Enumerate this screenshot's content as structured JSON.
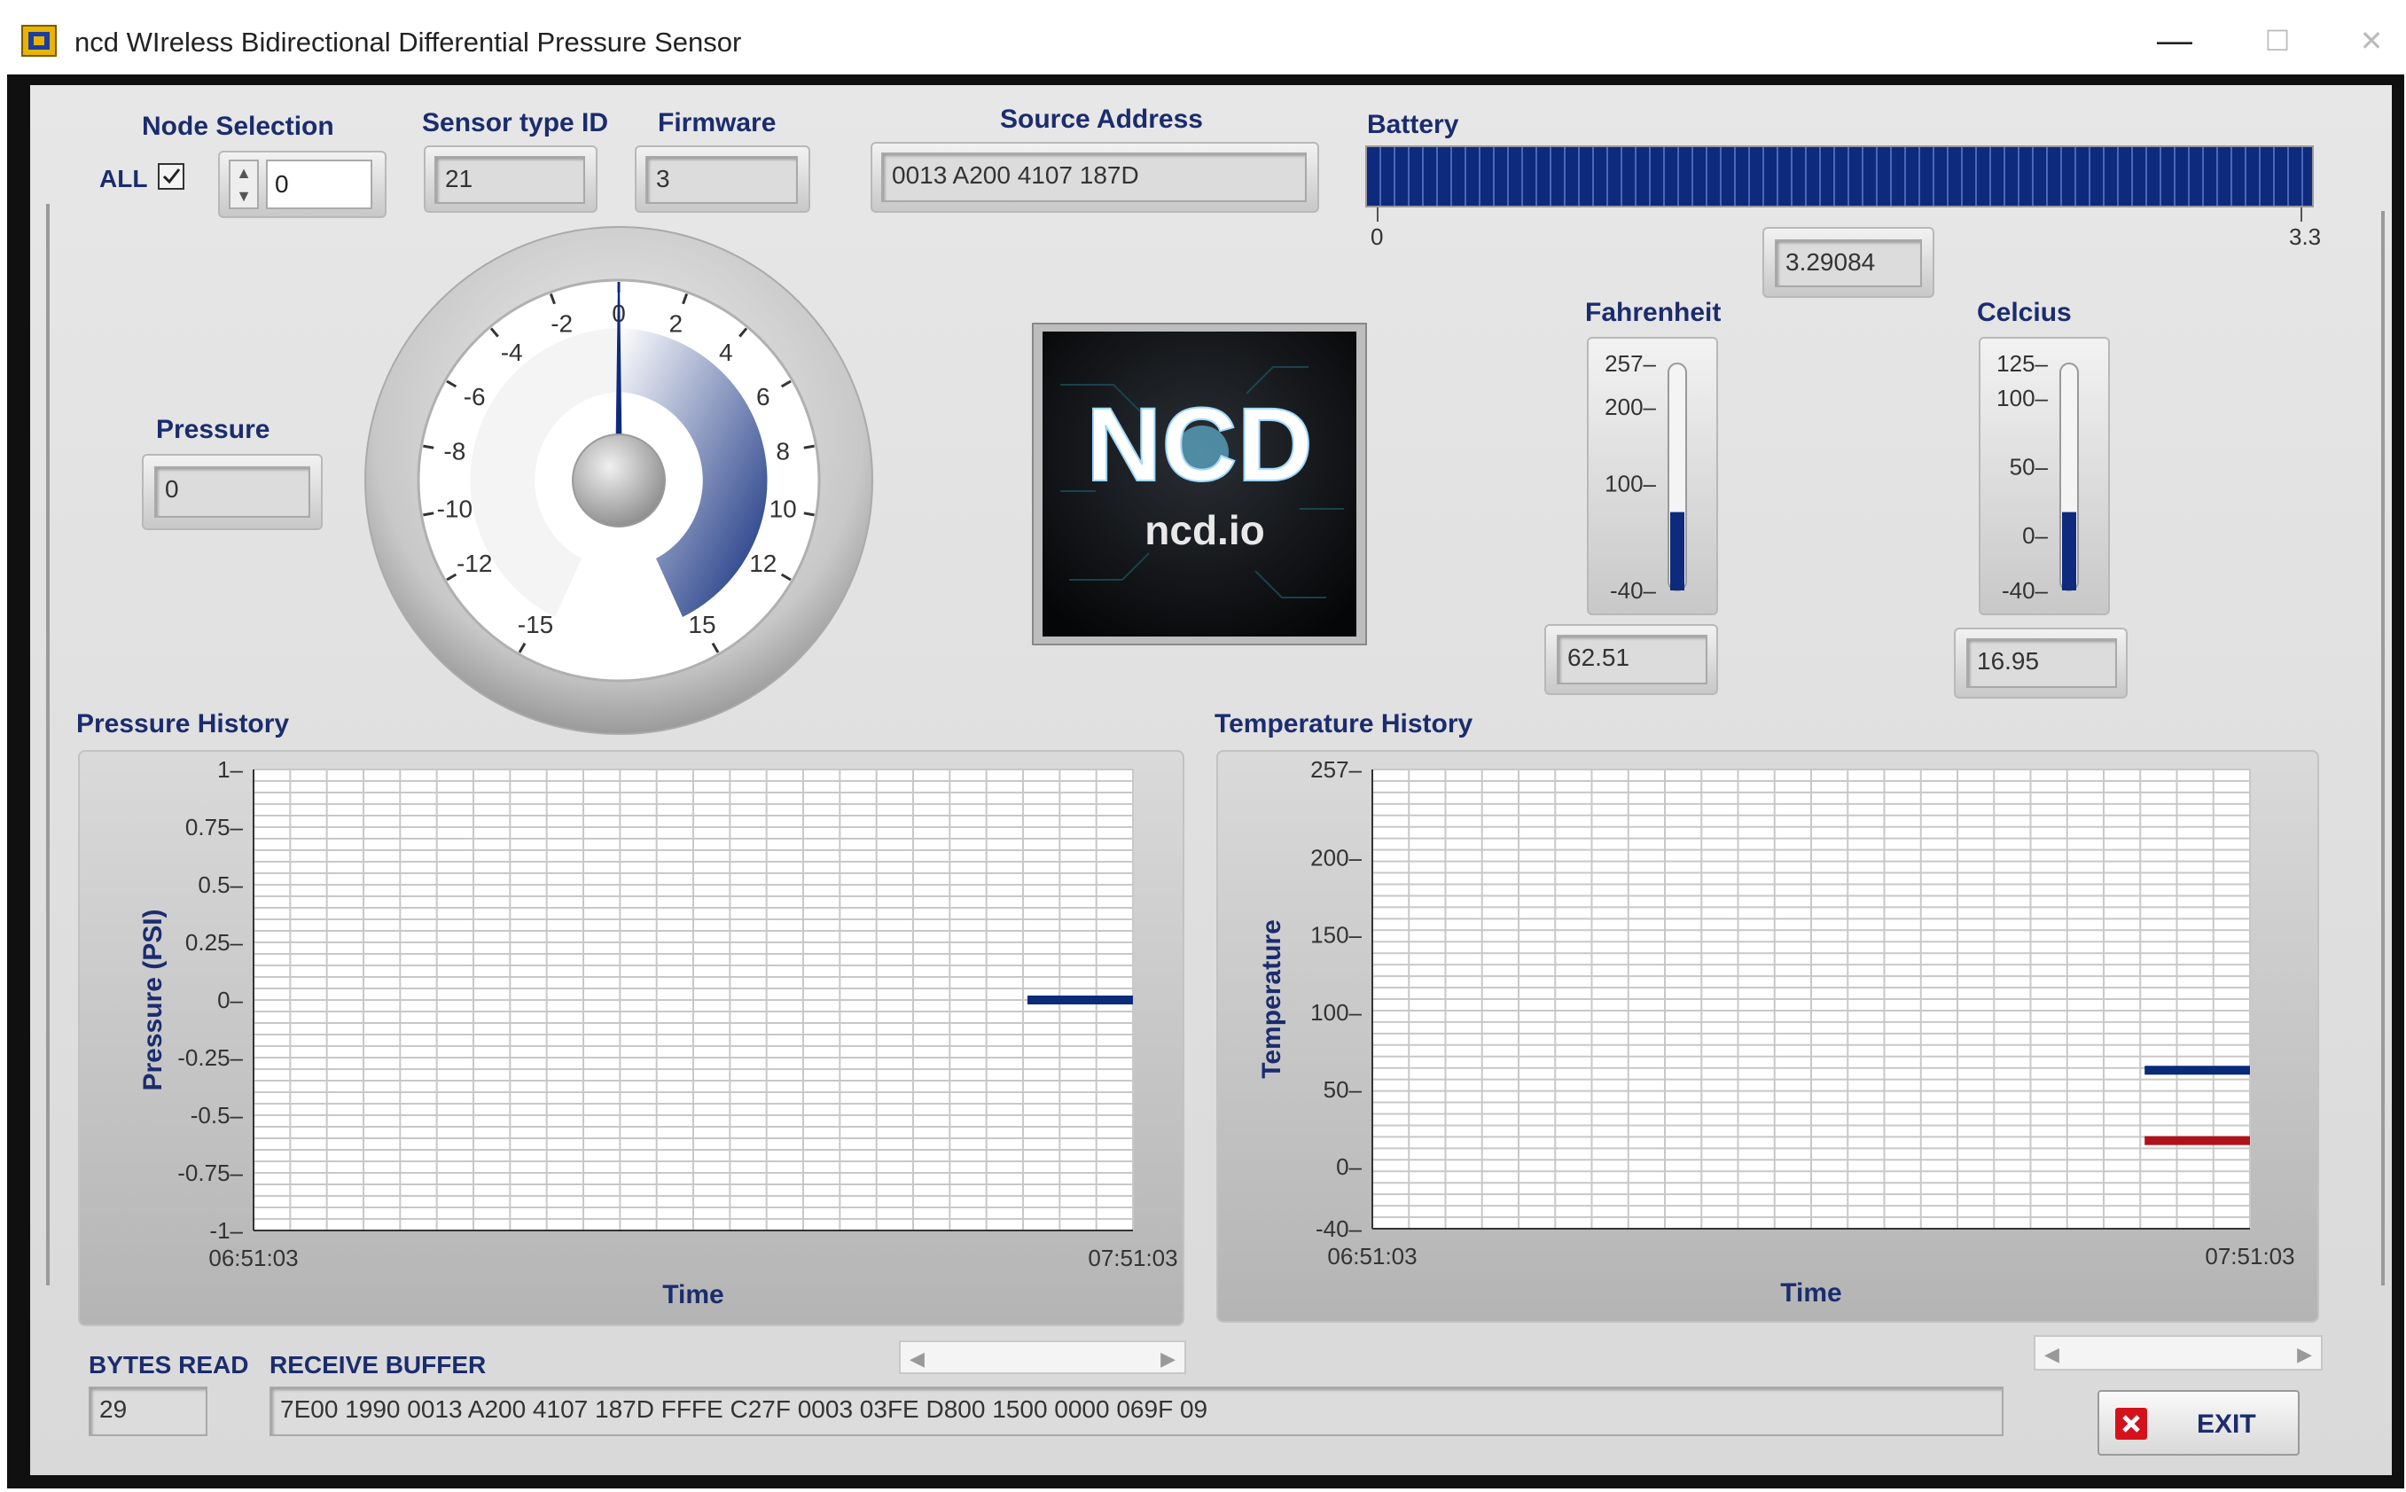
{
  "window": {
    "title": "ncd WIreless Bidirectional Differential Pressure Sensor",
    "minimize_glyph": "—",
    "maximize_glyph": "☐",
    "close_glyph": "✕"
  },
  "header": {
    "node_selection_label": "Node Selection",
    "all_label": "ALL",
    "all_checked": true,
    "node_value": "0",
    "sensor_type_label": "Sensor type ID",
    "sensor_type_value": "21",
    "firmware_label": "Firmware",
    "firmware_value": "3",
    "source_address_label": "Source Address",
    "source_address_value": "0013 A200 4107 187D"
  },
  "battery": {
    "label": "Battery",
    "min_label": "0",
    "max_label": "3.3",
    "level_fraction": 1.0,
    "value": "3.29084"
  },
  "pressure": {
    "label": "Pressure",
    "value": "0",
    "gauge_labels": [
      "-15",
      "-12",
      "-10",
      "-8",
      "-6",
      "-4",
      "-2",
      "0",
      "2",
      "4",
      "6",
      "8",
      "10",
      "12",
      "15"
    ],
    "gauge_value": 0
  },
  "logo": {
    "brand": "NCD",
    "site": "ncd.io"
  },
  "fahrenheit": {
    "label": "Fahrenheit",
    "scale": [
      "257",
      "200",
      "100",
      "-40"
    ],
    "value": "62.51",
    "level": 62.51
  },
  "celcius": {
    "label": "Celcius",
    "scale": [
      "125",
      "100",
      "50",
      "0",
      "-40"
    ],
    "value": "16.95",
    "level": 16.95
  },
  "pressure_history": {
    "title": "Pressure History",
    "ylabel": "Pressure (PSI)",
    "xlabel": "Time",
    "yticks": [
      "1",
      "0.75",
      "0.5",
      "0.25",
      "0",
      "-0.25",
      "-0.5",
      "-0.75",
      "-1"
    ],
    "xstart": "06:51:03",
    "xend": "07:51:03"
  },
  "temperature_history": {
    "title": "Temperature History",
    "ylabel": "Temperature",
    "xlabel": "Time",
    "yticks": [
      "257",
      "200",
      "150",
      "100",
      "50",
      "0",
      "-40"
    ],
    "xstart": "06:51:03",
    "xend": "07:51:03"
  },
  "footer": {
    "bytes_read_label": "BYTES READ",
    "bytes_read_value": "29",
    "receive_buffer_label": "RECEIVE BUFFER",
    "receive_buffer_value": "7E00 1990 0013 A200 4107 187D FFFE C27F 0003 03FE D800 1500 0000 069F 09",
    "exit_label": "EXIT"
  },
  "chart_data": [
    {
      "type": "line",
      "title": "Pressure History",
      "xlabel": "Time",
      "ylabel": "Pressure (PSI)",
      "ylim": [
        -1,
        1
      ],
      "x_range": [
        "06:51:03",
        "07:51:03"
      ],
      "grid": true,
      "series": [
        {
          "color": "#0a2a7a",
          "x": [
            0.88,
            1.0
          ],
          "values": [
            0,
            0
          ]
        }
      ]
    },
    {
      "type": "line",
      "title": "Temperature History",
      "xlabel": "Time",
      "ylabel": "Temperature",
      "ylim": [
        -40,
        257
      ],
      "x_range": [
        "06:51:03",
        "07:51:03"
      ],
      "grid": true,
      "series": [
        {
          "color": "#0a2a7a",
          "x": [
            0.88,
            1.0
          ],
          "values": [
            62.51,
            62.51
          ]
        },
        {
          "color": "#b0121a",
          "x": [
            0.88,
            1.0
          ],
          "values": [
            16.95,
            16.95
          ]
        }
      ]
    }
  ],
  "colors": {
    "label_blue": "#1b2c6e",
    "indicator_blue": "#0a2a7a",
    "series_red": "#b0121a"
  }
}
